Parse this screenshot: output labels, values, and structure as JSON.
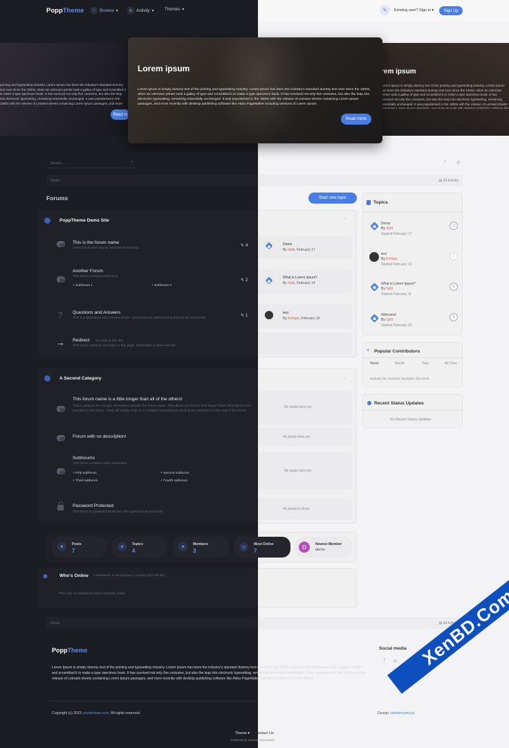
{
  "header": {
    "logo_part1": "Popp",
    "logo_part2": "Theme",
    "nav": [
      {
        "label": "Browse",
        "icon": "home-icon"
      },
      {
        "label": "Activity",
        "icon": "activity-icon"
      },
      {
        "label": "Themes",
        "icon": ""
      }
    ],
    "signin_label": "Existing user? Sign in",
    "signup_label": "Sign Up"
  },
  "hero": {
    "title": "Lorem ipsum",
    "text": "Lorem Ipsum is simply dummy text of the printing and typesetting industry. Lorem Ipsum has been the industry's standard dummy text ever since the 1500s, when an unknown printer took a galley of type and scrambled it to make a type specimen book. It has survived not only five centuries, but also the leap into electronic typesetting, remaining essentially unchanged. It was popularised in the 1960s with the release of Letraset sheets containing Lorem Ipsum passages, and more recently with desktop publishing software like Aldus PageMaker including versions of Lorem Ipsum.",
    "button": "Read more",
    "left_text": "printing and typesetting industry. Lorem Ipsum has been the industry's standard dummy text ever since the 1500s, when an unknown printer took a galley of type and scrambled it to make a type specimen book. It has survived not only five centuries, but also the leap into electronic typesetting, remaining essentially unchanged. It was popularised in the 1960s with the release of Letraset sheets containing Lorem Ipsum passages, and more recently with desktop publishing software",
    "left_button": "Read m",
    "right_title": "rem ipsum",
    "right_text": "Lorem Ipsum is simply dummy text of the printing and typesetting industry. Lorem Ipsum has been the industry's standard dummy text ever since the 1500s, when an unknown printer took a galley of type and scrambled it to make a type specimen book. It has survived not only five centuries, but also the leap into electronic typesetting, remaining essentially unchanged. It was popularised in the 1960s with the release of Letraset sheets containing Lorem Ipsum passages, and more recently with desktop publishing software like Aldus PageMaker including versions of Lorem Ipsum."
  },
  "search_placeholder": "Search...",
  "breadcrumb": {
    "home": "Home",
    "all_activity": "All Activity"
  },
  "page": {
    "title": "Forums",
    "start_topic": "Start new topic"
  },
  "categories": [
    {
      "title": "PoppTheme Demo Site",
      "forums": [
        {
          "title": "This is the forum name",
          "desc": "A test forum that may be selected in any step",
          "count": "4",
          "last_title": "Demo",
          "last_by": "By",
          "last_user": "Split",
          "last_date": "February 17",
          "avatar": "◆"
        },
        {
          "title": "Another Forum",
          "desc": "This forum contains subforums",
          "sub1": "Subforum 1",
          "sub2": "Subforum 2",
          "count": "2",
          "last_title": "What is Lorem Ipsum?",
          "last_by": "By",
          "last_user": "Split",
          "last_date": "February 14",
          "avatar": "◆"
        },
        {
          "title": "Questions and Answers",
          "desc": "This is a Questions and Answers forum. Questions are asked and questions are answered.",
          "count": "1",
          "last_title": "test",
          "last_by": "By",
          "last_user": "Krillaps",
          "last_date": "February 10",
          "avatar": "●"
        },
        {
          "title": "Redirect",
          "meta": "12 visits to this link",
          "desc": "This forum redirects you back to this page. Essentially a dead end link!"
        }
      ]
    },
    {
      "title": "A Second Category",
      "forums": [
        {
          "title": "This forum name is a little longer than all of the others!",
          "desc": "This is going to be a longer description just like the forum name. This allows you to see how longer forum descriptions are handled by the theme. They will simply wrap on to multiple lines without causing any disruption to the rest of the theme.",
          "empty": "No posts here yet"
        },
        {
          "title": "Forum with no description!",
          "empty": "No posts here yet"
        },
        {
          "title": "Subforums",
          "desc": "This forum contains many subforums",
          "subs": [
            "First subforum",
            "Second subforum",
            "Third subforum",
            "Fourth subforum"
          ],
          "empty": "No posts here yet"
        },
        {
          "title": "Password Protected",
          "desc": "This forum is password protected. The password is password",
          "empty": "No posts to show"
        }
      ]
    }
  ],
  "stats": [
    {
      "label": "Posts",
      "value": "7"
    },
    {
      "label": "Topics",
      "value": "4"
    },
    {
      "label": "Members",
      "value": "3"
    },
    {
      "label": "Most Online",
      "value": "7"
    }
  ],
  "newest_member": {
    "label": "Newest Member",
    "name": "demo",
    "initial": "D"
  },
  "whos_online": {
    "title": "Who's Online",
    "meta": "1 Members, 0 Anonymous, 1 Guest (See full list)",
    "empty": "There are no registered users currently online"
  },
  "sidebar": {
    "topics_title": "Topics",
    "topics": [
      {
        "title": "Demo",
        "by": "By",
        "user": "Split",
        "started": "Started February 17",
        "replies": "1"
      },
      {
        "title": "test",
        "by": "By",
        "user": "Krillaps",
        "started": "Started February 10",
        "replies": "1"
      },
      {
        "title": "What is Lorem Ipsum?",
        "by": "By",
        "user": "Split",
        "started": "Started February 11",
        "replies": "1"
      },
      {
        "title": "Welcome!",
        "by": "By",
        "user": "Split",
        "started": "Started February 12",
        "replies": "1"
      }
    ],
    "contrib_title": "Popular Contributors",
    "contrib_tabs": [
      "Week",
      "Month",
      "Year",
      "All Time"
    ],
    "contrib_empty": "Nobody has received reputation this week.",
    "status_title": "Recent Status Updates",
    "status_empty": "No Recent Status Updates"
  },
  "footer": {
    "text": "Lorem Ipsum is simply dummy text of the printing and typesetting industry. Lorem Ipsum has been the industry's standard dummy text ever since the 1500s, when an unknown printer took a galley of type and scrambled it to make a type specimen book. It has survived not only five centuries, but also the leap into electronic typesetting, remaining essentially unchanged. It was popularised in the 1960s with the release of Letraset sheets containing Lorem Ipsum passages, and more recently with desktop publishing software like Aldus PageMaker including versions of Lorem Ipsum.",
    "social_title": "Social media",
    "copyright_prefix": "Copyright (c) 2023",
    "copyright_link": "yourdomain.com",
    "copyright_suffix": ". All rights reserved.",
    "design_prefix": "Design:",
    "design_link": "adammystra.pl",
    "theme_label": "Theme",
    "contact_label": "Contact Us",
    "powered": "Powered by Invision Community"
  },
  "watermark": "XenBD.Com",
  "colors": {
    "accent": "#4a7ce8",
    "dark_bg": "#1c1d22",
    "light_bg": "#f3f3f5",
    "username": "#e05c5c"
  }
}
